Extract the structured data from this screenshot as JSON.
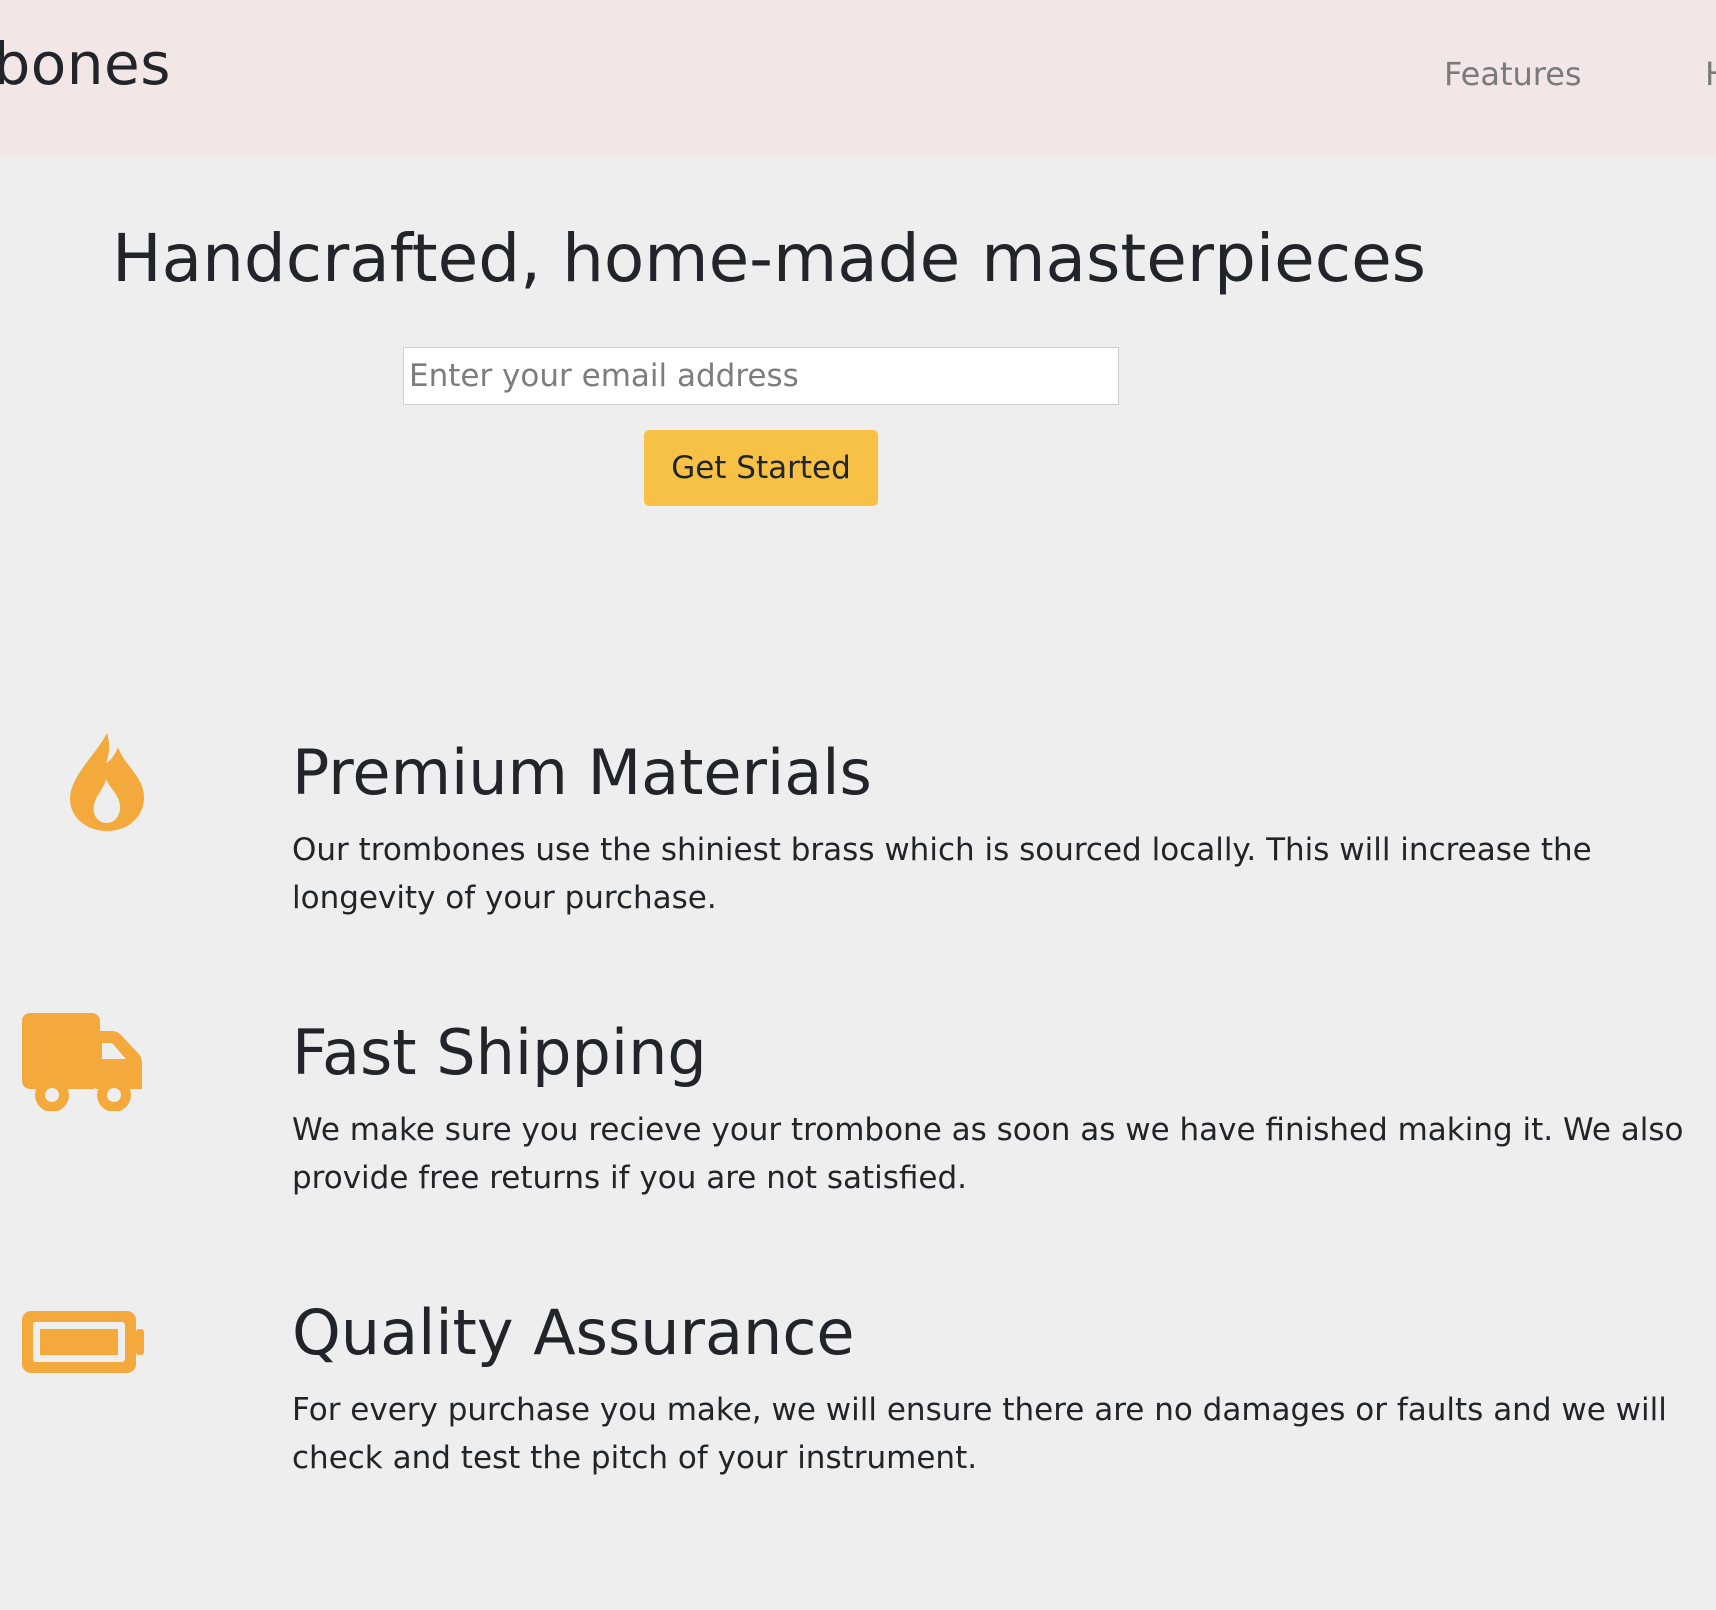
{
  "nav": {
    "brand": "Trombones",
    "links": [
      "Features",
      "How It Works"
    ]
  },
  "hero": {
    "title": "Handcrafted, home-made masterpieces",
    "email_placeholder": "Enter your email address",
    "cta_label": "Get Started"
  },
  "features": [
    {
      "icon": "fire-icon",
      "title": "Premium Materials",
      "text": "Our trombones use the shiniest brass which is sourced locally. This will increase the longevity of your purchase."
    },
    {
      "icon": "truck-icon",
      "title": "Fast Shipping",
      "text": "We make sure you recieve your trombone as soon as we have finished making it. We also provide free returns if you are not satisfied."
    },
    {
      "icon": "battery-icon",
      "title": "Quality Assurance",
      "text": "For every purchase you make, we will ensure there are no damages or faults and we will check and test the pitch of your instrument."
    }
  ],
  "colors": {
    "header_bg": "#f3e6e6",
    "page_bg": "#eeeeee",
    "accent": "#f6c144",
    "icon": "#f4a93d"
  }
}
